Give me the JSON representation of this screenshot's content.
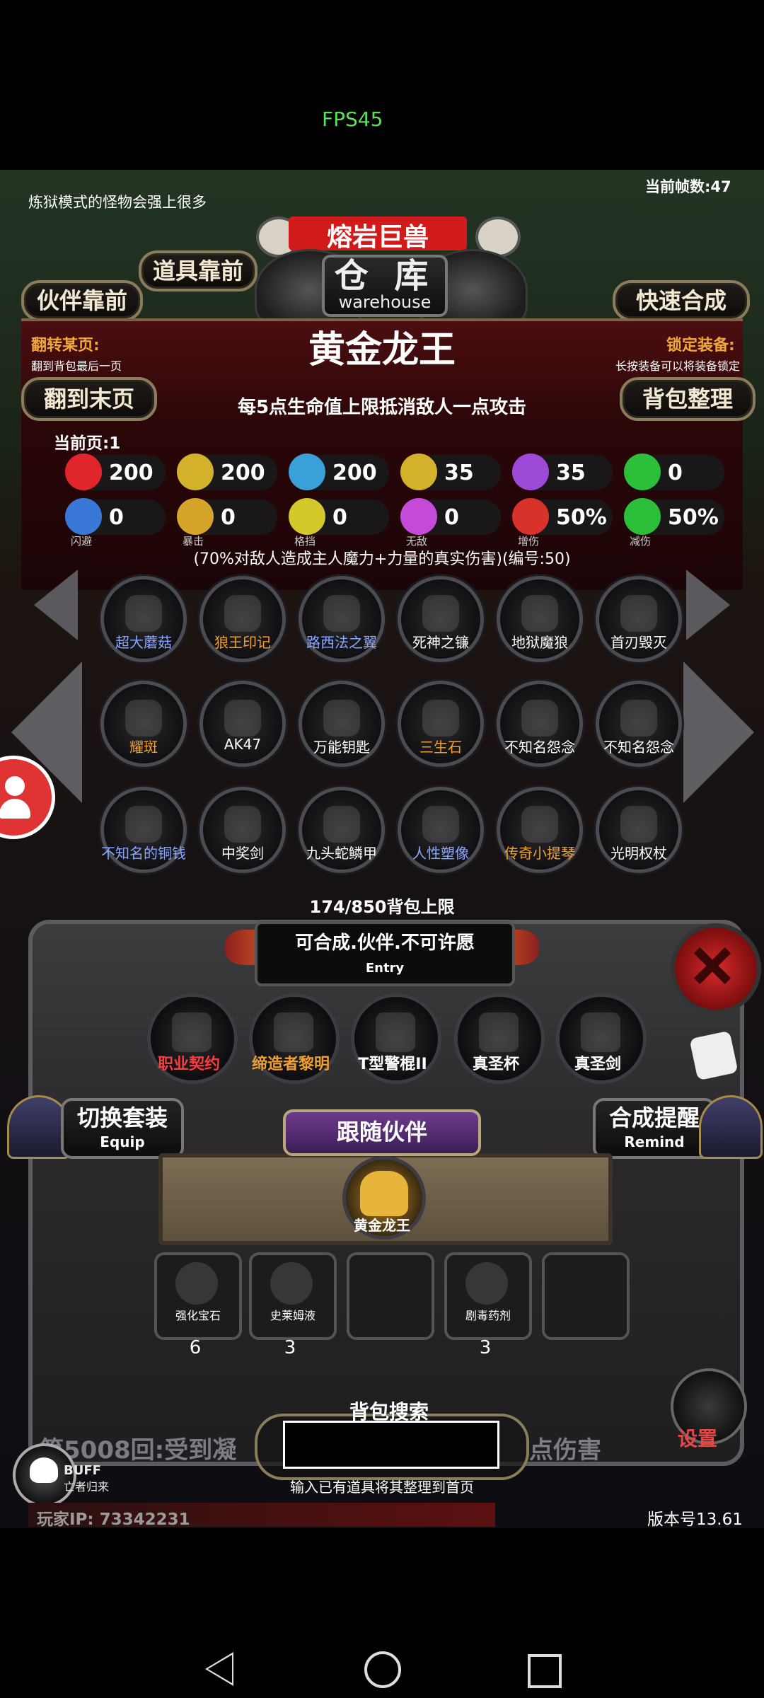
{
  "status": {
    "fps": "FPS45"
  },
  "hud": {
    "notice": "炼狱模式的怪物会强上很多",
    "frame_rate": "当前帧数:47",
    "boss_name": "熔岩巨兽"
  },
  "warehouse": {
    "title_cn": "仓 库",
    "title_en": "warehouse"
  },
  "nav": {
    "item_front": "道具靠前",
    "partner_front": "伙伴靠前",
    "quick_synth": "快速合成",
    "to_last_page": "翻到末页",
    "bag_sort": "背包整理"
  },
  "flip": {
    "label": "翻转某页:",
    "sub": "翻到背包最后一页",
    "current_page": "当前页:1"
  },
  "lock": {
    "label": "锁定装备:",
    "sub": "长按装备可以将装备锁定"
  },
  "selected": {
    "name": "黄金龙王",
    "description": "每5点生命值上限抵消敌人一点攻击",
    "effect": "(70%对敌人造成主人魔力+力量的真实伤害)(编号:50)"
  },
  "stats_row1": [
    {
      "icon": "heart-icon",
      "value": "200",
      "color": "#e0262b"
    },
    {
      "icon": "strength-icon",
      "value": "200",
      "color": "#d4b12a"
    },
    {
      "icon": "armor-icon",
      "value": "200",
      "color": "#3aa0d8"
    },
    {
      "icon": "speed-icon",
      "value": "35",
      "color": "#d4b12a"
    },
    {
      "icon": "magic-icon",
      "value": "35",
      "color": "#9d4ad8"
    },
    {
      "icon": "luck-icon",
      "value": "0",
      "color": "#2bbf3a"
    }
  ],
  "stats_row2": [
    {
      "icon": "dodge-icon",
      "value": "0",
      "label": "闪避",
      "color": "#3a78d8"
    },
    {
      "icon": "crit-icon",
      "value": "0",
      "label": "暴击",
      "color": "#d4a52a"
    },
    {
      "icon": "block-icon",
      "value": "0",
      "label": "格挡",
      "color": "#d4c82a"
    },
    {
      "icon": "invincible-icon",
      "value": "0",
      "label": "无敌",
      "color": "#c44ad8"
    },
    {
      "icon": "dmg-up-icon",
      "value": "50%",
      "label": "增伤",
      "color": "#d8322a"
    },
    {
      "icon": "dmg-down-icon",
      "value": "50%",
      "label": "减伤",
      "color": "#2bbf3a"
    }
  ],
  "items": [
    {
      "name": "超大蘑菇",
      "color": "#8aa6ff",
      "icon": "mushroom-icon"
    },
    {
      "name": "狼王印记",
      "color": "#f0a030",
      "icon": "wolf-mark-icon"
    },
    {
      "name": "路西法之翼",
      "color": "#8aa6ff",
      "icon": "wing-icon"
    },
    {
      "name": "死神之镰",
      "color": "#ffffff",
      "icon": "scythe-icon"
    },
    {
      "name": "地狱魔狼",
      "color": "#ffffff",
      "icon": "hellwolf-icon"
    },
    {
      "name": "首刃毁灭",
      "color": "#ffffff",
      "icon": "blade-icon"
    },
    {
      "name": "耀斑",
      "color": "#f0a030",
      "icon": "flare-icon"
    },
    {
      "name": "AK47",
      "color": "#ffffff",
      "icon": "rifle-icon"
    },
    {
      "name": "万能钥匙",
      "color": "#ffffff",
      "icon": "key-icon"
    },
    {
      "name": "三生石",
      "color": "#f0a030",
      "icon": "stone-icon"
    },
    {
      "name": "不知名怨念",
      "color": "#ffffff",
      "icon": "ghost-icon"
    },
    {
      "name": "不知名怨念",
      "color": "#ffffff",
      "icon": "ghost-icon"
    },
    {
      "name": "不知名的铜钱",
      "color": "#8aa6ff",
      "icon": "coin-icon"
    },
    {
      "name": "中奖剑",
      "color": "#ffffff",
      "icon": "sword-icon"
    },
    {
      "name": "九头蛇鳞甲",
      "color": "#ffffff",
      "icon": "hydra-armor-icon"
    },
    {
      "name": "人性塑像",
      "color": "#8aa6ff",
      "icon": "statue-icon"
    },
    {
      "name": "传奇小提琴",
      "color": "#f0a030",
      "icon": "violin-icon"
    },
    {
      "name": "光明权杖",
      "color": "#ffffff",
      "icon": "scepter-icon"
    }
  ],
  "bag": {
    "capacity": "174/850背包上限"
  },
  "entry": {
    "title": "可合成.伙伴.不可许愿",
    "sub": "Entry"
  },
  "equipped": [
    {
      "name": "职业契约",
      "color": "#ff3a3a",
      "icon": "contract-icon"
    },
    {
      "name": "缔造者黎明",
      "color": "#f0a030",
      "icon": "creator-dawn-icon"
    },
    {
      "name": "T型警棍II",
      "color": "#ffffff",
      "icon": "baton-icon"
    },
    {
      "name": "真圣杯",
      "color": "#ffffff",
      "icon": "grail-icon"
    },
    {
      "name": "真圣剑",
      "color": "#ffffff",
      "icon": "holy-sword-icon"
    }
  ],
  "equip_btn": {
    "title": "切换套装",
    "sub": "Equip"
  },
  "remind_btn": {
    "title": "合成提醒",
    "sub": "Remind"
  },
  "follow": {
    "tag": "跟随伙伴",
    "partner_name": "黄金龙王"
  },
  "inventory": [
    {
      "name": "强化宝石",
      "count": "6",
      "icon": "gem-icon"
    },
    {
      "name": "史莱姆液",
      "count": "3",
      "icon": "potion-icon"
    },
    {
      "name": "",
      "count": "",
      "icon": ""
    },
    {
      "name": "剧毒药剂",
      "count": "3",
      "icon": "poison-icon"
    },
    {
      "name": "",
      "count": "",
      "icon": ""
    }
  ],
  "search": {
    "title": "背包搜索",
    "hint": "输入已有道具将其整理到首页",
    "value": ""
  },
  "combat": {
    "left": "第5008回:受到凝",
    "right": "点伤害"
  },
  "buff": {
    "label": "BUFF",
    "sub": "亡者归来"
  },
  "settings": {
    "label": "设置"
  },
  "footer": {
    "ip": "玩家IP:  73342231",
    "version": "版本号13.61"
  }
}
